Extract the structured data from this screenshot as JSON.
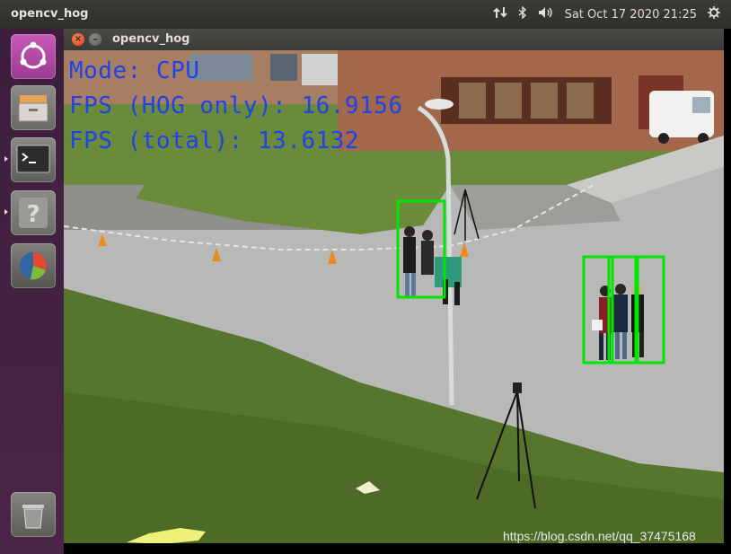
{
  "panel": {
    "app_title": "opencv_hog",
    "datetime": "Sat Oct 17 2020 21:25",
    "icons": [
      "network-icon",
      "bluetooth-icon",
      "volume-icon",
      "power-gear-icon"
    ]
  },
  "launcher": {
    "items": [
      {
        "name": "ubuntu-dash-icon"
      },
      {
        "name": "file-manager-icon"
      },
      {
        "name": "terminal-icon"
      },
      {
        "name": "unknown-app-icon"
      },
      {
        "name": "system-monitor-icon"
      },
      {
        "name": "trash-icon"
      }
    ]
  },
  "window": {
    "title": "opencv_hog",
    "close_glyph": "×",
    "minimize_glyph": "–"
  },
  "overlay": {
    "mode": "Mode: CPU",
    "fps_hog": "FPS (HOG only): 16.9156",
    "fps_total": "FPS (total): 13.6132",
    "text_color": "#1f43e8",
    "box_color": "#00e600"
  },
  "watermark": "https://blog.csdn.net/qq_37475168",
  "colors": {
    "launcher_bg": "#432142",
    "panel_bg": "#3c3b37",
    "ubuntu_orange": "#dd4814"
  }
}
